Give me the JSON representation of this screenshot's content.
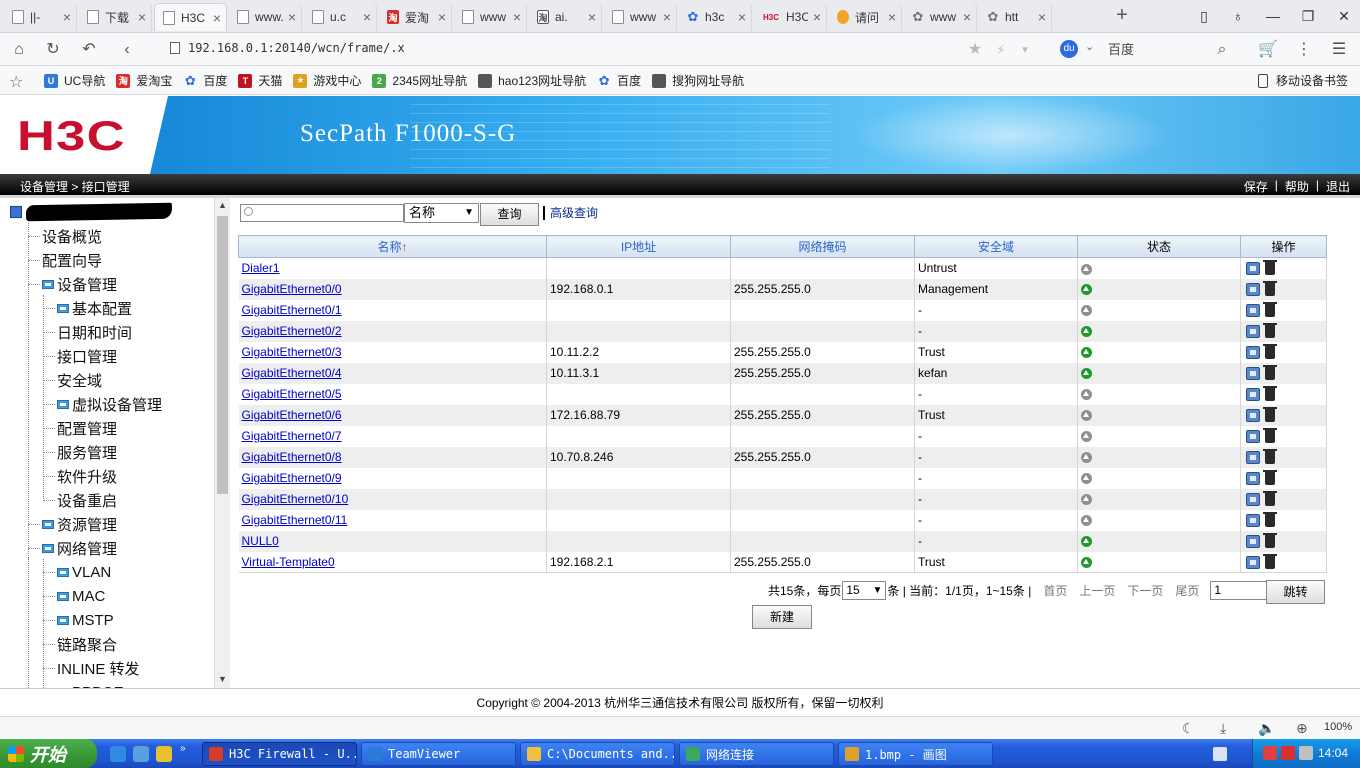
{
  "browser": {
    "tabs": [
      {
        "title": "||-",
        "icon": "doc-icon",
        "active": false,
        "w": 73
      },
      {
        "title": "下载",
        "icon": "doc-icon",
        "active": false,
        "w": 73
      },
      {
        "title": "H3C",
        "icon": "doc-icon",
        "active": true,
        "w": 73
      },
      {
        "title": "www.",
        "icon": "doc-icon",
        "active": false,
        "w": 73
      },
      {
        "title": "u.c",
        "icon": "doc-icon",
        "active": false,
        "w": 73
      },
      {
        "title": "爱淘",
        "icon": "taobao-icon",
        "active": false,
        "w": 73
      },
      {
        "title": "www",
        "icon": "doc-icon",
        "active": false,
        "w": 73
      },
      {
        "title": "ai.",
        "icon": "ai-icon",
        "active": false,
        "w": 73
      },
      {
        "title": "www",
        "icon": "doc-icon",
        "active": false,
        "w": 73
      },
      {
        "title": "h3c",
        "icon": "baidu-paw-icon",
        "active": false,
        "w": 73
      },
      {
        "title": "H3C",
        "icon": "h3c-icon",
        "active": false,
        "w": 73
      },
      {
        "title": "请问",
        "icon": "question-icon",
        "active": false,
        "w": 73
      },
      {
        "title": "www",
        "icon": "paw-icon",
        "active": false,
        "w": 73
      },
      {
        "title": "htt",
        "icon": "paw-icon",
        "active": false,
        "w": 73
      }
    ],
    "new_tab": "+",
    "url": "192.168.0.1:20140/wcn/frame/.x",
    "search_engine": "百度",
    "bookmarks": [
      {
        "label": "UC导航",
        "icon": "uc-icon",
        "color": "#2e7bd6"
      },
      {
        "label": "爱淘宝",
        "icon": "taobao-icon",
        "color": "#d72c2c"
      },
      {
        "label": "百度",
        "icon": "baidu-paw-icon",
        "color": "#2b6de0"
      },
      {
        "label": "天猫",
        "icon": "tmall-icon",
        "color": "#c1121f"
      },
      {
        "label": "游戏中心",
        "icon": "game-icon",
        "color": "#e0a020"
      },
      {
        "label": "2345网址导航",
        "icon": "2345-icon",
        "color": "#4aa84a"
      },
      {
        "label": "hao123网址导航",
        "icon": "doc-icon",
        "color": "#555555"
      },
      {
        "label": "百度",
        "icon": "baidu-paw-icon",
        "color": "#2b6de0"
      },
      {
        "label": "搜狗网址导航",
        "icon": "doc-icon",
        "color": "#555555"
      }
    ],
    "mobile_bookmarks": "移动设备书签",
    "zoom": "100%"
  },
  "banner": {
    "logo": "H3C",
    "product": "SecPath F1000-S-G"
  },
  "crumbs": {
    "path": "设备管理 > 接口管理",
    "links": [
      "保存",
      "帮助",
      "退出"
    ]
  },
  "nav": {
    "items": [
      {
        "label": "设备概览",
        "level": 1,
        "folder": false
      },
      {
        "label": "配置向导",
        "level": 1,
        "folder": false
      },
      {
        "label": "设备管理",
        "level": 1,
        "folder": true
      },
      {
        "label": "基本配置",
        "level": 2,
        "folder": true
      },
      {
        "label": "日期和时间",
        "level": 2,
        "folder": false
      },
      {
        "label": "接口管理",
        "level": 2,
        "folder": false
      },
      {
        "label": "安全域",
        "level": 2,
        "folder": false
      },
      {
        "label": "虚拟设备管理",
        "level": 2,
        "folder": true
      },
      {
        "label": "配置管理",
        "level": 2,
        "folder": false
      },
      {
        "label": "服务管理",
        "level": 2,
        "folder": false
      },
      {
        "label": "软件升级",
        "level": 2,
        "folder": false
      },
      {
        "label": "设备重启",
        "level": 2,
        "folder": false
      },
      {
        "label": "资源管理",
        "level": 1,
        "folder": true
      },
      {
        "label": "网络管理",
        "level": 1,
        "folder": true
      },
      {
        "label": "VLAN",
        "level": 2,
        "folder": true
      },
      {
        "label": "MAC",
        "level": 2,
        "folder": true
      },
      {
        "label": "MSTP",
        "level": 2,
        "folder": true
      },
      {
        "label": "链路聚合",
        "level": 2,
        "folder": false
      },
      {
        "label": "INLINE 转发",
        "level": 2,
        "folder": false
      },
      {
        "label": "PPPOE",
        "level": 2,
        "folder": true
      }
    ]
  },
  "search": {
    "value": "",
    "field": "名称",
    "query_label": "查询",
    "advanced_label": "高级查询"
  },
  "table": {
    "columns": [
      "名称",
      "IP地址",
      "网络掩码",
      "安全域",
      "状态",
      "操作"
    ],
    "sort_indicator": "↑",
    "rows": [
      {
        "name": "Dialer1",
        "ip": "",
        "mask": "",
        "zone": "Untrust",
        "up": false
      },
      {
        "name": "GigabitEthernet0/0",
        "ip": "192.168.0.1",
        "mask": "255.255.255.0",
        "zone": "Management",
        "up": true
      },
      {
        "name": "GigabitEthernet0/1",
        "ip": "",
        "mask": "",
        "zone": "-",
        "up": false
      },
      {
        "name": "GigabitEthernet0/2",
        "ip": "",
        "mask": "",
        "zone": "-",
        "up": true
      },
      {
        "name": "GigabitEthernet0/3",
        "ip": "10.11.2.2",
        "mask": "255.255.255.0",
        "zone": "Trust",
        "up": true
      },
      {
        "name": "GigabitEthernet0/4",
        "ip": "10.11.3.1",
        "mask": "255.255.255.0",
        "zone": "kefan",
        "up": true
      },
      {
        "name": "GigabitEthernet0/5",
        "ip": "",
        "mask": "",
        "zone": "-",
        "up": false
      },
      {
        "name": "GigabitEthernet0/6",
        "ip": "172.16.88.79",
        "mask": "255.255.255.0",
        "zone": "Trust",
        "up": false
      },
      {
        "name": "GigabitEthernet0/7",
        "ip": "",
        "mask": "",
        "zone": "-",
        "up": false
      },
      {
        "name": "GigabitEthernet0/8",
        "ip": "10.70.8.246",
        "mask": "255.255.255.0",
        "zone": "-",
        "up": false
      },
      {
        "name": "GigabitEthernet0/9",
        "ip": "",
        "mask": "",
        "zone": "-",
        "up": false
      },
      {
        "name": "GigabitEthernet0/10",
        "ip": "",
        "mask": "",
        "zone": "-",
        "up": false
      },
      {
        "name": "GigabitEthernet0/11",
        "ip": "",
        "mask": "",
        "zone": "-",
        "up": false
      },
      {
        "name": "NULL0",
        "ip": "",
        "mask": "",
        "zone": "-",
        "up": true
      },
      {
        "name": "Virtual-Template0",
        "ip": "192.168.2.1",
        "mask": "255.255.255.0",
        "zone": "Trust",
        "up": true
      }
    ]
  },
  "pager": {
    "total_prefix": "共15条，每页",
    "page_size": "15",
    "status": "条 | 当前：1/1页，1~15条 |",
    "first": "首页",
    "prev": "上一页",
    "next": "下一页",
    "last": "尾页",
    "page_input": "1",
    "jump": "跳转"
  },
  "new_button": "新建",
  "footer": "Copyright © 2004-2013 杭州华三通信技术有限公司 版权所有，保留一切权利",
  "taskbar": {
    "start": "开始",
    "tasks": [
      {
        "label": "H3C Firewall - U...",
        "color": "#d63c2a",
        "active": true,
        "w": 155
      },
      {
        "label": "TeamViewer",
        "color": "#2b7ad8",
        "active": false,
        "w": 155
      },
      {
        "label": "C:\\Documents and...",
        "color": "#f0c040",
        "active": false,
        "w": 155
      },
      {
        "label": "网络连接",
        "color": "#3aa860",
        "active": false,
        "w": 155
      },
      {
        "label": "1.bmp - 画图",
        "color": "#e0a030",
        "active": false,
        "w": 155
      }
    ],
    "clock": "14:04"
  },
  "colors": {
    "brand_red": "#c8102e",
    "header_link": "#2a64c8",
    "link": "#0000cc",
    "status_up": "#1c9a2b",
    "status_down": "#8f8f8f"
  }
}
